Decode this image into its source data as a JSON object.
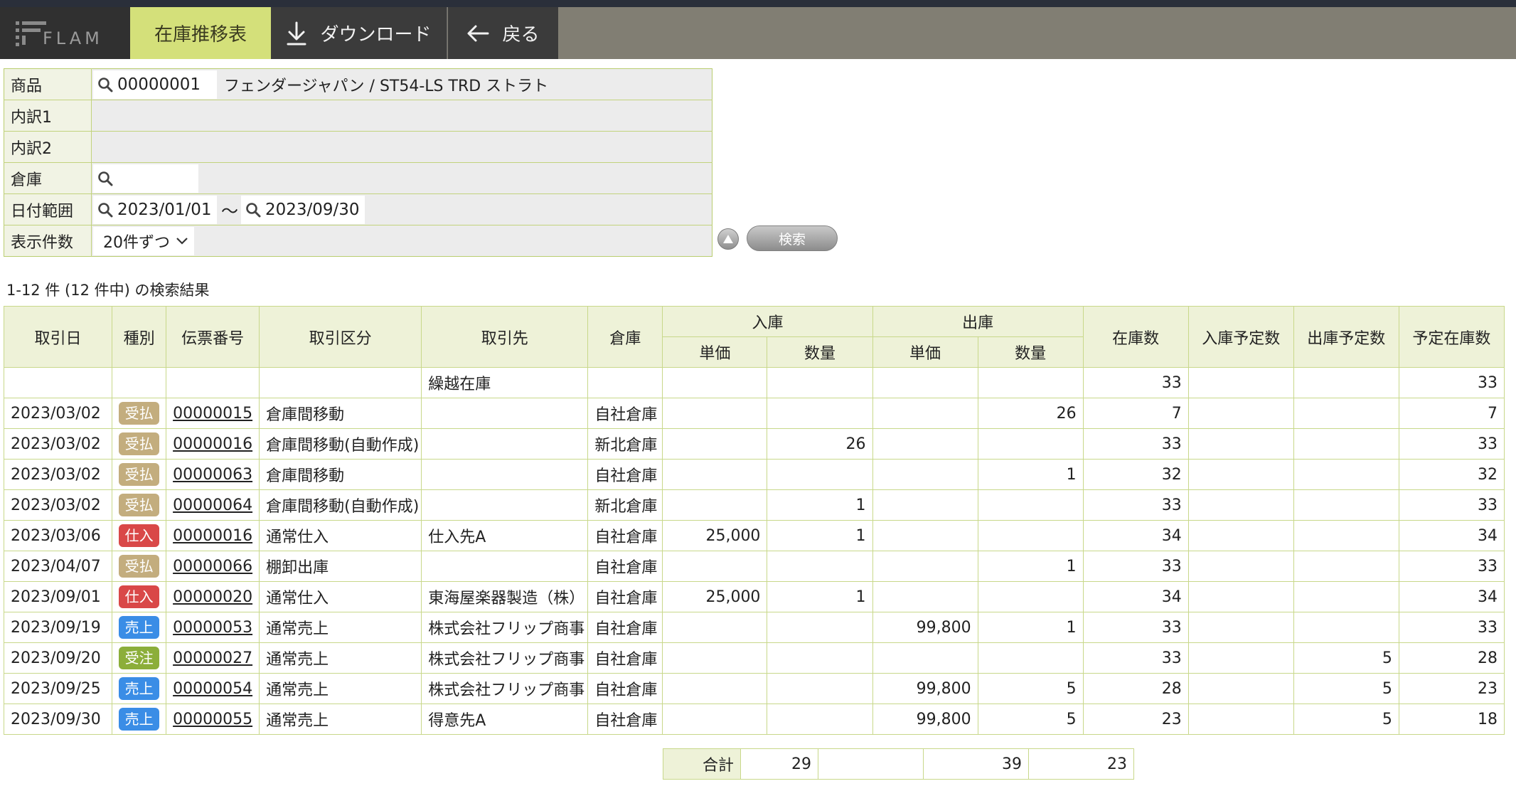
{
  "app": {
    "logo": "FLAM"
  },
  "toolbar": {
    "active_tab": "在庫推移表",
    "download_label": "ダウンロード",
    "back_label": "戻る"
  },
  "search": {
    "labels": {
      "product": "商品",
      "detail1": "内訳1",
      "detail2": "内訳2",
      "warehouse": "倉庫",
      "date_range": "日付範囲",
      "per_page": "表示件数"
    },
    "product_code": "00000001",
    "product_name": "フェンダージャパン / ST54-LS TRD ストラト",
    "warehouse": "",
    "date_from": "2023/01/01",
    "tilde": "～",
    "date_to": "2023/09/30",
    "per_page": "20件ずつ",
    "search_button": "検索"
  },
  "results": {
    "summary": "1-12 件 (12 件中) の検索結果",
    "headers": {
      "date": "取引日",
      "type": "種別",
      "slip": "伝票番号",
      "category": "取引区分",
      "partner": "取引先",
      "warehouse": "倉庫",
      "incoming": "入庫",
      "outgoing": "出庫",
      "unit_price": "単価",
      "qty": "数量",
      "stock": "在庫数",
      "planned_in": "入庫予定数",
      "planned_out": "出庫予定数",
      "planned_stock": "予定在庫数"
    },
    "carryover": {
      "partner": "繰越在庫",
      "stock": "33",
      "planned_stock": "33"
    },
    "badge_colors": {
      "受払": "#c3ad7e",
      "仕入": "#d94848",
      "売上": "#3a8de6",
      "受注": "#8cae3a"
    },
    "rows": [
      {
        "date": "2023/03/02",
        "type": "受払",
        "slip": "00000015",
        "category": "倉庫間移動",
        "partner": "",
        "warehouse": "自社倉庫",
        "in_price": "",
        "in_qty": "",
        "out_price": "",
        "out_qty": "26",
        "stock": "7",
        "planned_in": "",
        "planned_out": "",
        "planned_stock": "7"
      },
      {
        "date": "2023/03/02",
        "type": "受払",
        "slip": "00000016",
        "category": "倉庫間移動(自動作成)",
        "partner": "",
        "warehouse": "新北倉庫",
        "in_price": "",
        "in_qty": "26",
        "out_price": "",
        "out_qty": "",
        "stock": "33",
        "planned_in": "",
        "planned_out": "",
        "planned_stock": "33"
      },
      {
        "date": "2023/03/02",
        "type": "受払",
        "slip": "00000063",
        "category": "倉庫間移動",
        "partner": "",
        "warehouse": "自社倉庫",
        "in_price": "",
        "in_qty": "",
        "out_price": "",
        "out_qty": "1",
        "stock": "32",
        "planned_in": "",
        "planned_out": "",
        "planned_stock": "32"
      },
      {
        "date": "2023/03/02",
        "type": "受払",
        "slip": "00000064",
        "category": "倉庫間移動(自動作成)",
        "partner": "",
        "warehouse": "新北倉庫",
        "in_price": "",
        "in_qty": "1",
        "out_price": "",
        "out_qty": "",
        "stock": "33",
        "planned_in": "",
        "planned_out": "",
        "planned_stock": "33"
      },
      {
        "date": "2023/03/06",
        "type": "仕入",
        "slip": "00000016",
        "category": "通常仕入",
        "partner": "仕入先A",
        "warehouse": "自社倉庫",
        "in_price": "25,000",
        "in_qty": "1",
        "out_price": "",
        "out_qty": "",
        "stock": "34",
        "planned_in": "",
        "planned_out": "",
        "planned_stock": "34"
      },
      {
        "date": "2023/04/07",
        "type": "受払",
        "slip": "00000066",
        "category": "棚卸出庫",
        "partner": "",
        "warehouse": "自社倉庫",
        "in_price": "",
        "in_qty": "",
        "out_price": "",
        "out_qty": "1",
        "stock": "33",
        "planned_in": "",
        "planned_out": "",
        "planned_stock": "33"
      },
      {
        "date": "2023/09/01",
        "type": "仕入",
        "slip": "00000020",
        "category": "通常仕入",
        "partner": "東海屋楽器製造（株）",
        "warehouse": "自社倉庫",
        "in_price": "25,000",
        "in_qty": "1",
        "out_price": "",
        "out_qty": "",
        "stock": "34",
        "planned_in": "",
        "planned_out": "",
        "planned_stock": "34"
      },
      {
        "date": "2023/09/19",
        "type": "売上",
        "slip": "00000053",
        "category": "通常売上",
        "partner": "株式会社フリップ商事",
        "warehouse": "自社倉庫",
        "in_price": "",
        "in_qty": "",
        "out_price": "99,800",
        "out_qty": "1",
        "stock": "33",
        "planned_in": "",
        "planned_out": "",
        "planned_stock": "33"
      },
      {
        "date": "2023/09/20",
        "type": "受注",
        "slip": "00000027",
        "category": "通常売上",
        "partner": "株式会社フリップ商事",
        "warehouse": "自社倉庫",
        "in_price": "",
        "in_qty": "",
        "out_price": "",
        "out_qty": "",
        "stock": "33",
        "planned_in": "",
        "planned_out": "5",
        "planned_stock": "28"
      },
      {
        "date": "2023/09/25",
        "type": "売上",
        "slip": "00000054",
        "category": "通常売上",
        "partner": "株式会社フリップ商事",
        "warehouse": "自社倉庫",
        "in_price": "",
        "in_qty": "",
        "out_price": "99,800",
        "out_qty": "5",
        "stock": "28",
        "planned_in": "",
        "planned_out": "5",
        "planned_stock": "23"
      },
      {
        "date": "2023/09/30",
        "type": "売上",
        "slip": "00000055",
        "category": "通常売上",
        "partner": "得意先A",
        "warehouse": "自社倉庫",
        "in_price": "",
        "in_qty": "",
        "out_price": "99,800",
        "out_qty": "5",
        "stock": "23",
        "planned_in": "",
        "planned_out": "5",
        "planned_stock": "18"
      }
    ],
    "totals": {
      "label": "合計",
      "in_qty": "29",
      "out_price": "",
      "out_qty": "39",
      "stock": "23"
    }
  }
}
